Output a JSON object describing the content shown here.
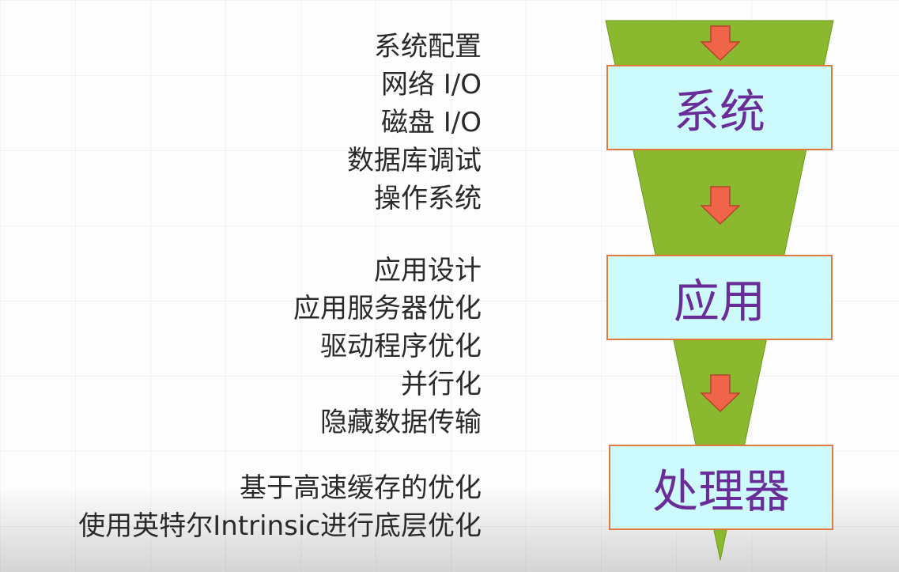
{
  "layers": [
    {
      "title": "系统",
      "items": [
        "系统配置",
        "网络 I/O",
        "磁盘 I/O",
        "数据库调试",
        "操作系统"
      ]
    },
    {
      "title": "应用",
      "items": [
        "应用设计",
        "应用服务器优化",
        "驱动程序优化",
        "并行化",
        "隐藏数据传输"
      ]
    },
    {
      "title": "处理器",
      "items": [
        "基于高速缓存的优化",
        "使用英特尔Intrinsic进行底层优化"
      ]
    }
  ],
  "colors": {
    "funnel": "#8ab82f",
    "arrow": "#f0654a",
    "box_fill": "#cdfbfd",
    "box_border": "#e07b3c",
    "box_text": "#6a2c98"
  }
}
